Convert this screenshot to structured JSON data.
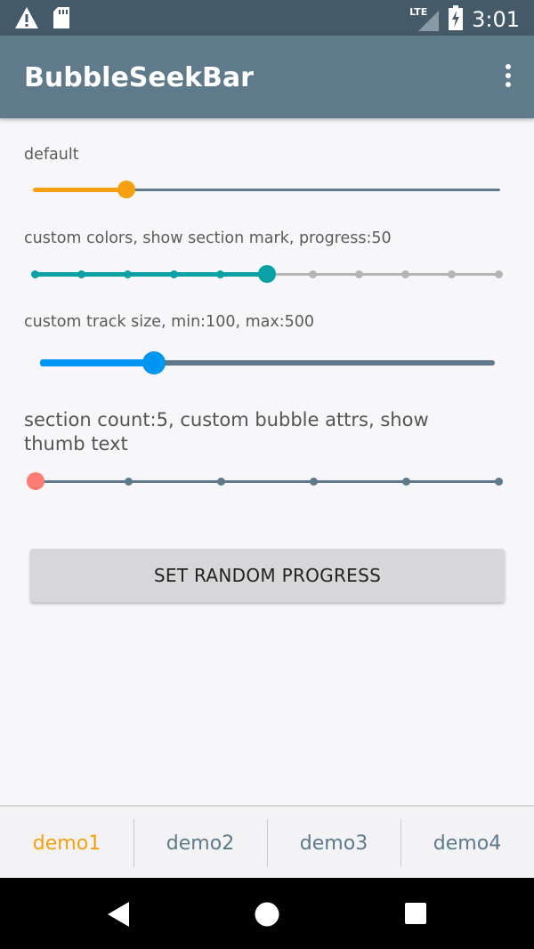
{
  "status_bar": {
    "network": "LTE",
    "time": "3:01",
    "icons": [
      "warning-icon",
      "sd-card-icon",
      "signal-icon",
      "battery-charging-icon"
    ]
  },
  "app_bar": {
    "title": "BubbleSeekBar",
    "menu_icon": "overflow-menu-icon"
  },
  "seekbars": [
    {
      "label": "default",
      "progress_fraction": 0.2,
      "colors": {
        "active": "#f5a013",
        "inactive": "#5e7a8b",
        "thumb": "#f5a013"
      }
    },
    {
      "label": "custom colors, show section mark, progress:50",
      "progress": 50,
      "section_marks": 10,
      "colors": {
        "active": "#0aa1a6",
        "inactive": "#b5b5b5",
        "thumb": "#0aa1a6"
      }
    },
    {
      "label": "custom track size, min:100, max:500",
      "min": 100,
      "max": 500,
      "progress_fraction": 0.25,
      "colors": {
        "active": "#0095f0",
        "inactive": "#5e7a8b",
        "thumb": "#0095f0"
      }
    },
    {
      "label": "section count:5, custom bubble attrs, show thumb text",
      "section_count": 5,
      "progress_fraction": 0,
      "colors": {
        "active": "#5e7a8b",
        "inactive": "#5e7a8b",
        "thumb": "#fc7b72"
      }
    }
  ],
  "button": {
    "label": "SET RANDOM PROGRESS"
  },
  "tabs": [
    {
      "label": "demo1",
      "active": true
    },
    {
      "label": "demo2",
      "active": false
    },
    {
      "label": "demo3",
      "active": false
    },
    {
      "label": "demo4",
      "active": false
    }
  ],
  "nav_bar": {
    "icons": [
      "back-icon",
      "home-icon",
      "recents-icon"
    ]
  },
  "colors": {
    "accent": "#f5a013",
    "primary": "#5e7a8b",
    "primary_dark": "#455a68"
  }
}
